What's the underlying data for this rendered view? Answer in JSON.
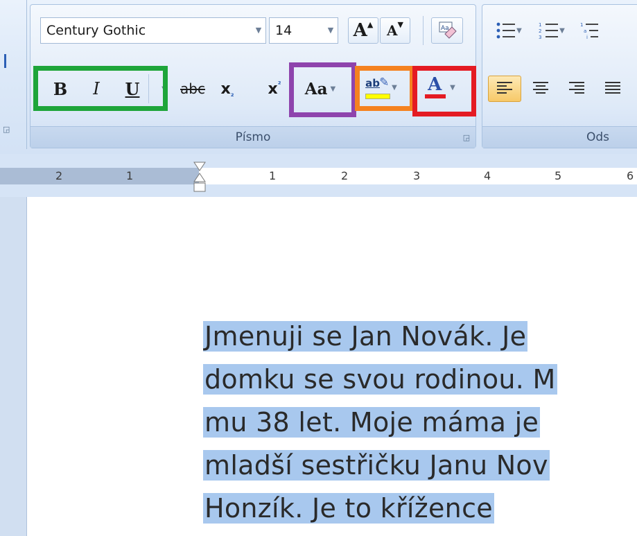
{
  "ribbon": {
    "font_group": {
      "title": "Písmo",
      "font_name": "Century Gothic",
      "font_size": "14",
      "bold_label": "B",
      "italic_label": "I",
      "underline_label": "U",
      "strike_label": "abc",
      "subscript_label": "x",
      "superscript_label": "x",
      "case_label": "Aa",
      "highlight_label": "ab",
      "font_color_label": "A",
      "grow_label": "A",
      "shrink_label": "A"
    },
    "paragraph_group": {
      "title": "Ods"
    }
  },
  "highlight_boxes": {
    "green": "#1ea53a",
    "purple": "#8e44ad",
    "orange": "#f58220",
    "red": "#e41b23"
  },
  "ruler": {
    "numbers": [
      "2",
      "1",
      "1",
      "2",
      "3",
      "4",
      "5",
      "6"
    ]
  },
  "document": {
    "lines": [
      "Jmenuji se Jan Novák. Je",
      "domku se svou rodinou. M",
      "mu 38 let. Moje máma je",
      "mladší sestřičku Janu Nov",
      "Honzík. Je to křížence"
    ]
  },
  "colors": {
    "selection": "#a8c8ee",
    "font_color_bar": "#e41b23",
    "highlight_bar": "#ffff00"
  }
}
